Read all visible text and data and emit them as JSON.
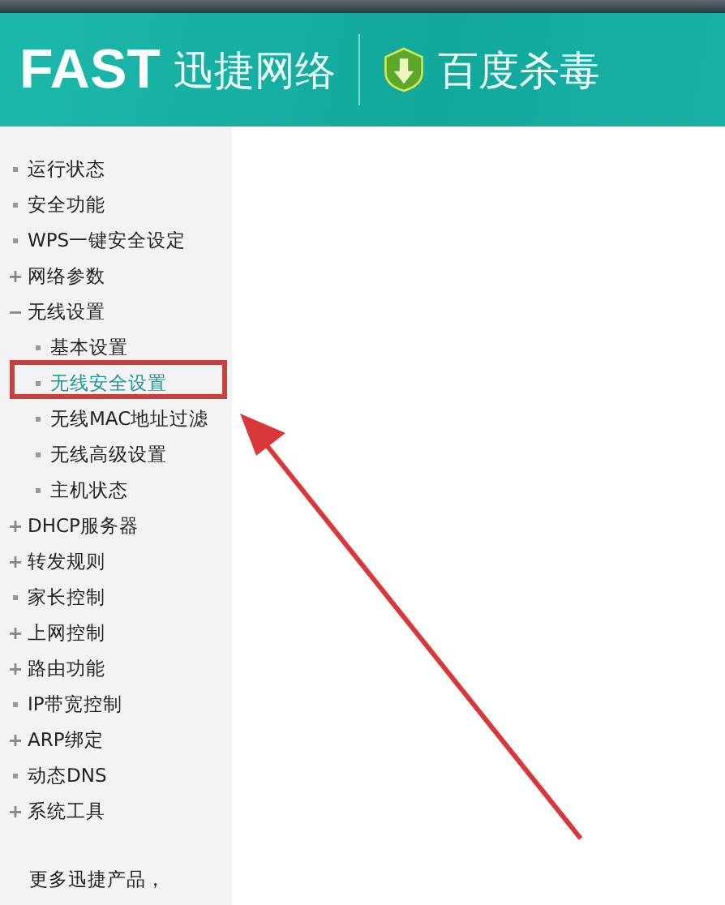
{
  "header": {
    "logo": "FAST",
    "brand": "迅捷网络",
    "partner": "百度杀毒"
  },
  "sidebar": {
    "items": [
      {
        "label": "运行状态",
        "kind": "leaf",
        "selected": false
      },
      {
        "label": "安全功能",
        "kind": "leaf",
        "selected": false
      },
      {
        "label": "WPS一键安全设定",
        "kind": "leaf",
        "selected": false
      },
      {
        "label": "网络参数",
        "kind": "group",
        "expanded": false,
        "selected": false
      },
      {
        "label": "无线设置",
        "kind": "group",
        "expanded": true,
        "selected": false,
        "children": [
          {
            "label": "基本设置",
            "kind": "leaf",
            "selected": false
          },
          {
            "label": "无线安全设置",
            "kind": "leaf",
            "selected": true
          },
          {
            "label": "无线MAC地址过滤",
            "kind": "leaf",
            "selected": false
          },
          {
            "label": "无线高级设置",
            "kind": "leaf",
            "selected": false
          },
          {
            "label": "主机状态",
            "kind": "leaf",
            "selected": false
          }
        ]
      },
      {
        "label": "DHCP服务器",
        "kind": "group",
        "expanded": false,
        "selected": false
      },
      {
        "label": "转发规则",
        "kind": "group",
        "expanded": false,
        "selected": false
      },
      {
        "label": "家长控制",
        "kind": "leaf",
        "selected": false
      },
      {
        "label": "上网控制",
        "kind": "group",
        "expanded": false,
        "selected": false
      },
      {
        "label": "路由功能",
        "kind": "group",
        "expanded": false,
        "selected": false
      },
      {
        "label": "IP带宽控制",
        "kind": "leaf",
        "selected": false
      },
      {
        "label": "ARP绑定",
        "kind": "group",
        "expanded": false,
        "selected": false
      },
      {
        "label": "动态DNS",
        "kind": "leaf",
        "selected": false
      },
      {
        "label": "系统工具",
        "kind": "group",
        "expanded": false,
        "selected": false
      }
    ],
    "footer": "更多迅捷产品，"
  }
}
